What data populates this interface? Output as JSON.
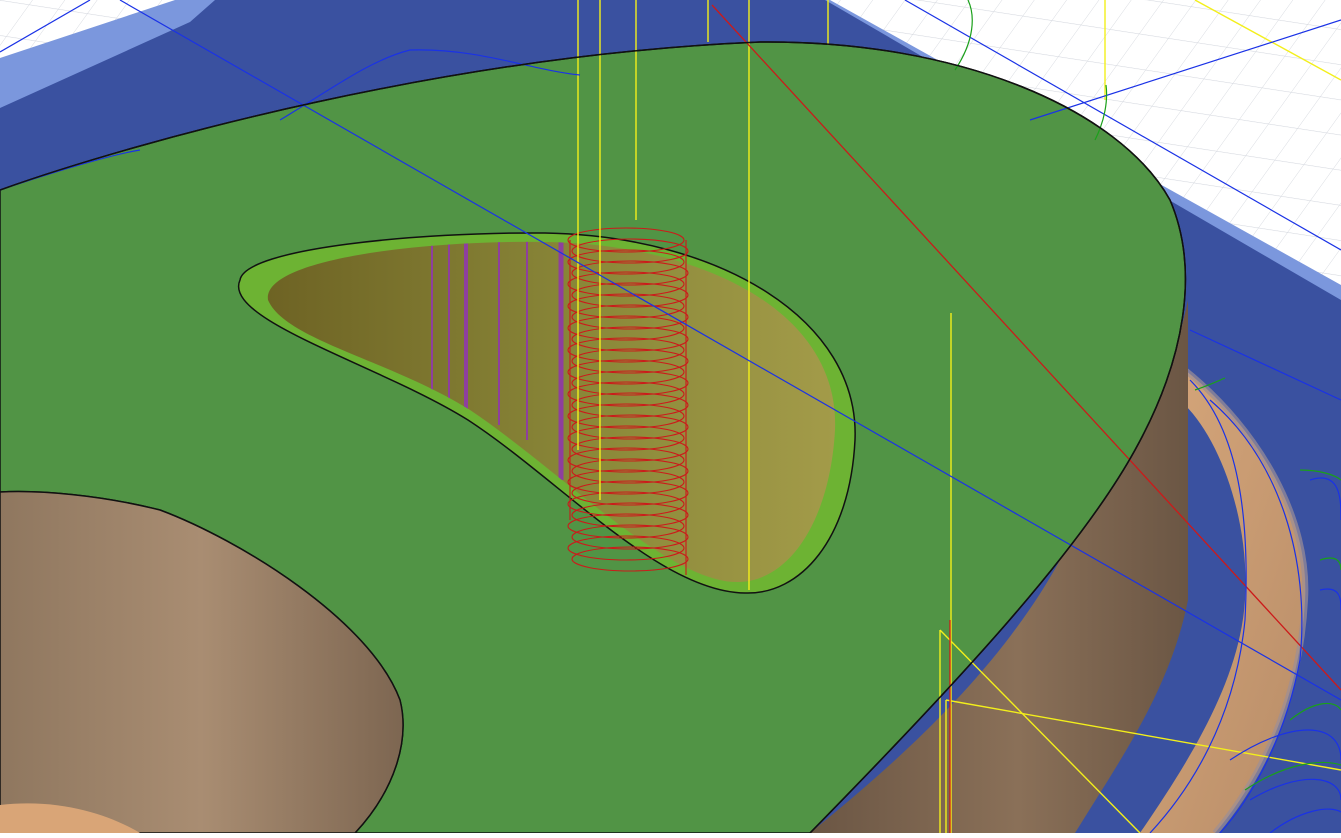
{
  "scene": {
    "type": "cam-toolpath-simulation-viewport",
    "colors": {
      "background": "#ffffff",
      "grid": "#d4d7de",
      "stock_border": "#7b97dd",
      "stock_floor": "#3a51a0",
      "top_face": "#519445",
      "machined_wall_light": "#9b7f66",
      "machined_wall_dark": "#6b5644",
      "pocket_floor": "#7a7a2c",
      "pocket_rim": "#6db333",
      "helix_toolpath": "#cc1a1a",
      "rapid_move": "#f3ef1b",
      "lead_move": "#cc1a1a",
      "cutting_path": "#1a32e6",
      "linking_path": "#1aa01a",
      "plunge_marks": "#8e3f9e",
      "edge": "#111111"
    },
    "icons": [
      "helical-ramp-icon",
      "rapid-move-line-icon",
      "contour-path-icon"
    ]
  }
}
